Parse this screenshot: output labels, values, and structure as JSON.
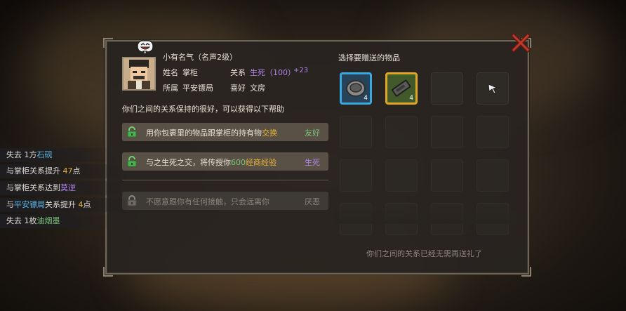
{
  "npc": {
    "title": "小有名气（名声2级）",
    "name_label": "姓名",
    "name": "掌柜",
    "relation_label": "关系",
    "relation": "生死（100）",
    "relation_bonus": "+23",
    "affiliation_label": "所属",
    "affiliation": "平安镖局",
    "hobby_label": "喜好",
    "hobby": "文房",
    "benefit_intro": "你们之间的关系保持的很好，可以获得以下帮助"
  },
  "benefits": [
    {
      "text_a": "用你包裹里的物品跟掌柜的持有物",
      "text_b": "交换",
      "tag": "友好",
      "unlocked": true
    },
    {
      "text_a": "与之生死之交，将传授你",
      "text_b": "600",
      "text_c": "经商经验",
      "tag": "生死",
      "unlocked": true
    },
    {
      "text_a": "不愿意跟你有任何接触，只会远离你",
      "tag": "厌恶",
      "unlocked": false
    }
  ],
  "gift": {
    "title": "选择要赠送的物品",
    "items": [
      {
        "icon": "inkstone-icon",
        "count": "4"
      },
      {
        "icon": "inkstick-icon",
        "count": "4"
      }
    ],
    "status": "你们之间的关系已经无需再送礼了"
  },
  "log": [
    {
      "a": "失去 1方",
      "b": "石砚",
      "b_color": "#5bb8e6"
    },
    {
      "a": "与掌柜关系提升 ",
      "b": "47",
      "b_color": "#e6b43c",
      "c": "点"
    },
    {
      "a": "与掌柜关系达到",
      "b": "莫逆",
      "b_color": "#b184e6"
    },
    {
      "a": "与",
      "b": "平安镖局",
      "b_color": "#5bb8e6",
      "c": "关系提升 ",
      "d": "4",
      "d_color": "#e6b43c",
      "e": "点"
    },
    {
      "a": "失去 1枚",
      "b": "油烟墨",
      "b_color": "#7ac47a"
    }
  ],
  "colors": {
    "accent_purple": "#b184e6",
    "accent_green": "#7ac47a",
    "accent_gold": "#e6b43c",
    "accent_blue": "#5bb8e6",
    "close_red": "#c0392b"
  }
}
